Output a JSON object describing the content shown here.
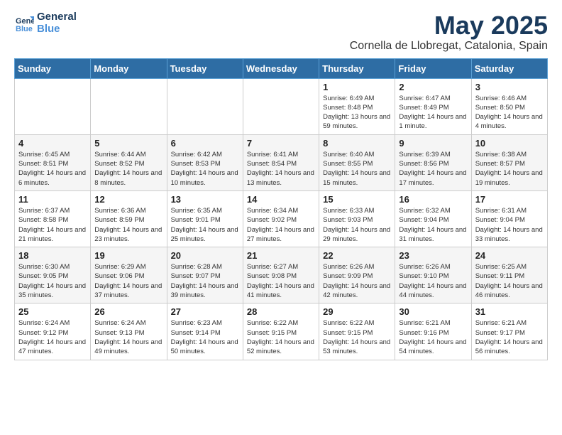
{
  "header": {
    "logo_line1": "General",
    "logo_line2": "Blue",
    "month_title": "May 2025",
    "subtitle": "Cornella de Llobregat, Catalonia, Spain"
  },
  "weekdays": [
    "Sunday",
    "Monday",
    "Tuesday",
    "Wednesday",
    "Thursday",
    "Friday",
    "Saturday"
  ],
  "weeks": [
    [
      {
        "day": "",
        "info": ""
      },
      {
        "day": "",
        "info": ""
      },
      {
        "day": "",
        "info": ""
      },
      {
        "day": "",
        "info": ""
      },
      {
        "day": "1",
        "info": "Sunrise: 6:49 AM\nSunset: 8:48 PM\nDaylight: 13 hours and 59 minutes."
      },
      {
        "day": "2",
        "info": "Sunrise: 6:47 AM\nSunset: 8:49 PM\nDaylight: 14 hours and 1 minute."
      },
      {
        "day": "3",
        "info": "Sunrise: 6:46 AM\nSunset: 8:50 PM\nDaylight: 14 hours and 4 minutes."
      }
    ],
    [
      {
        "day": "4",
        "info": "Sunrise: 6:45 AM\nSunset: 8:51 PM\nDaylight: 14 hours and 6 minutes."
      },
      {
        "day": "5",
        "info": "Sunrise: 6:44 AM\nSunset: 8:52 PM\nDaylight: 14 hours and 8 minutes."
      },
      {
        "day": "6",
        "info": "Sunrise: 6:42 AM\nSunset: 8:53 PM\nDaylight: 14 hours and 10 minutes."
      },
      {
        "day": "7",
        "info": "Sunrise: 6:41 AM\nSunset: 8:54 PM\nDaylight: 14 hours and 13 minutes."
      },
      {
        "day": "8",
        "info": "Sunrise: 6:40 AM\nSunset: 8:55 PM\nDaylight: 14 hours and 15 minutes."
      },
      {
        "day": "9",
        "info": "Sunrise: 6:39 AM\nSunset: 8:56 PM\nDaylight: 14 hours and 17 minutes."
      },
      {
        "day": "10",
        "info": "Sunrise: 6:38 AM\nSunset: 8:57 PM\nDaylight: 14 hours and 19 minutes."
      }
    ],
    [
      {
        "day": "11",
        "info": "Sunrise: 6:37 AM\nSunset: 8:58 PM\nDaylight: 14 hours and 21 minutes."
      },
      {
        "day": "12",
        "info": "Sunrise: 6:36 AM\nSunset: 8:59 PM\nDaylight: 14 hours and 23 minutes."
      },
      {
        "day": "13",
        "info": "Sunrise: 6:35 AM\nSunset: 9:01 PM\nDaylight: 14 hours and 25 minutes."
      },
      {
        "day": "14",
        "info": "Sunrise: 6:34 AM\nSunset: 9:02 PM\nDaylight: 14 hours and 27 minutes."
      },
      {
        "day": "15",
        "info": "Sunrise: 6:33 AM\nSunset: 9:03 PM\nDaylight: 14 hours and 29 minutes."
      },
      {
        "day": "16",
        "info": "Sunrise: 6:32 AM\nSunset: 9:04 PM\nDaylight: 14 hours and 31 minutes."
      },
      {
        "day": "17",
        "info": "Sunrise: 6:31 AM\nSunset: 9:04 PM\nDaylight: 14 hours and 33 minutes."
      }
    ],
    [
      {
        "day": "18",
        "info": "Sunrise: 6:30 AM\nSunset: 9:05 PM\nDaylight: 14 hours and 35 minutes."
      },
      {
        "day": "19",
        "info": "Sunrise: 6:29 AM\nSunset: 9:06 PM\nDaylight: 14 hours and 37 minutes."
      },
      {
        "day": "20",
        "info": "Sunrise: 6:28 AM\nSunset: 9:07 PM\nDaylight: 14 hours and 39 minutes."
      },
      {
        "day": "21",
        "info": "Sunrise: 6:27 AM\nSunset: 9:08 PM\nDaylight: 14 hours and 41 minutes."
      },
      {
        "day": "22",
        "info": "Sunrise: 6:26 AM\nSunset: 9:09 PM\nDaylight: 14 hours and 42 minutes."
      },
      {
        "day": "23",
        "info": "Sunrise: 6:26 AM\nSunset: 9:10 PM\nDaylight: 14 hours and 44 minutes."
      },
      {
        "day": "24",
        "info": "Sunrise: 6:25 AM\nSunset: 9:11 PM\nDaylight: 14 hours and 46 minutes."
      }
    ],
    [
      {
        "day": "25",
        "info": "Sunrise: 6:24 AM\nSunset: 9:12 PM\nDaylight: 14 hours and 47 minutes."
      },
      {
        "day": "26",
        "info": "Sunrise: 6:24 AM\nSunset: 9:13 PM\nDaylight: 14 hours and 49 minutes."
      },
      {
        "day": "27",
        "info": "Sunrise: 6:23 AM\nSunset: 9:14 PM\nDaylight: 14 hours and 50 minutes."
      },
      {
        "day": "28",
        "info": "Sunrise: 6:22 AM\nSunset: 9:15 PM\nDaylight: 14 hours and 52 minutes."
      },
      {
        "day": "29",
        "info": "Sunrise: 6:22 AM\nSunset: 9:15 PM\nDaylight: 14 hours and 53 minutes."
      },
      {
        "day": "30",
        "info": "Sunrise: 6:21 AM\nSunset: 9:16 PM\nDaylight: 14 hours and 54 minutes."
      },
      {
        "day": "31",
        "info": "Sunrise: 6:21 AM\nSunset: 9:17 PM\nDaylight: 14 hours and 56 minutes."
      }
    ]
  ]
}
